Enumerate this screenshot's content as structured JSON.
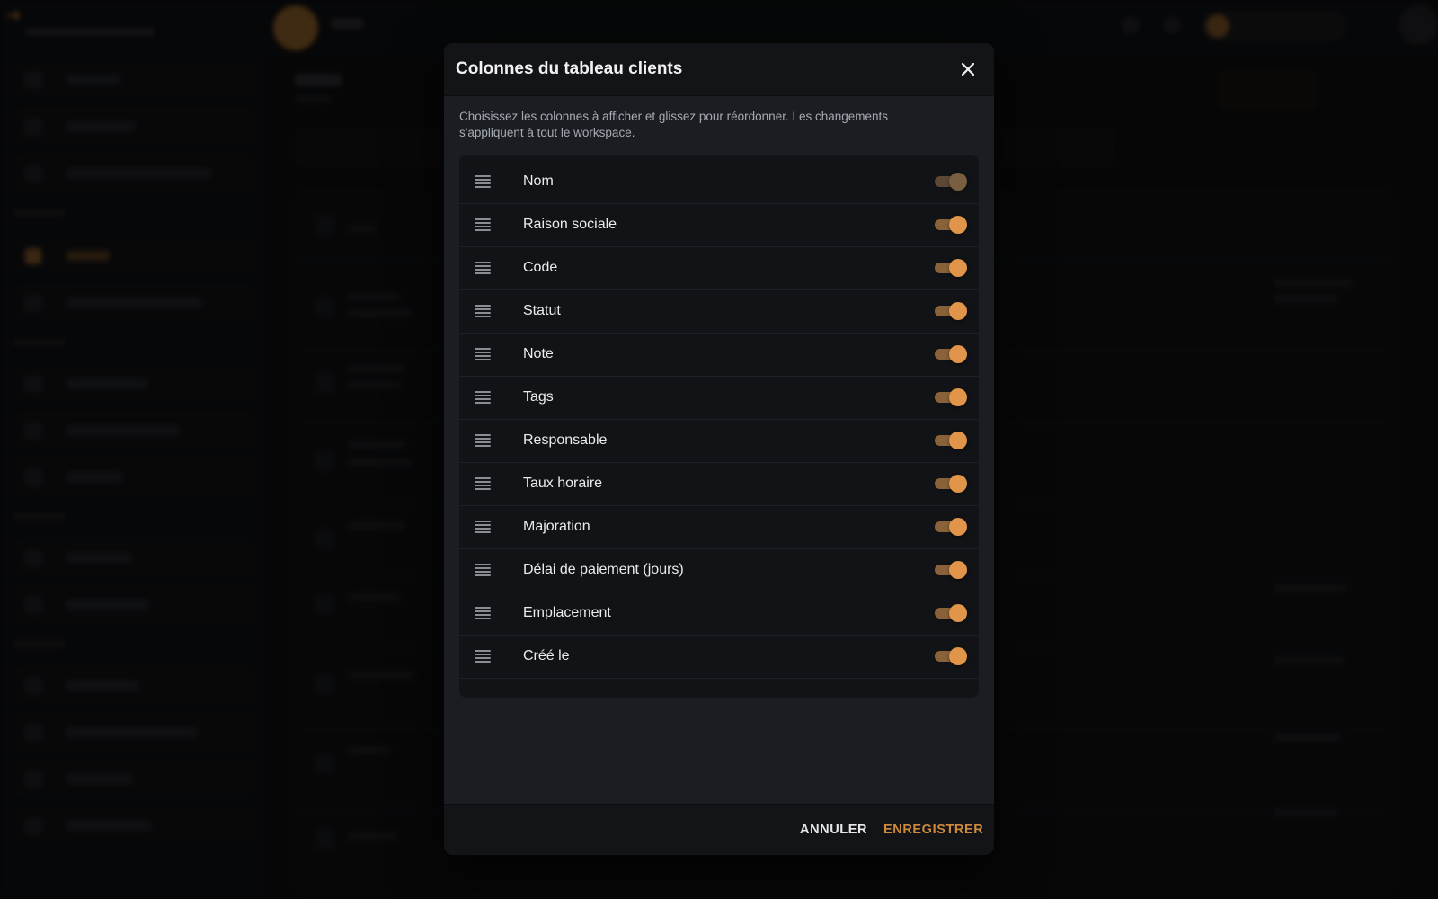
{
  "dialog": {
    "title": "Colonnes du tableau clients",
    "description": "Choisissez les colonnes à afficher et glissez pour réordonner. Les changements s'appliquent à tout le workspace.",
    "columns": [
      {
        "label": "Nom",
        "enabled": true,
        "locked": true
      },
      {
        "label": "Raison sociale",
        "enabled": true
      },
      {
        "label": "Code",
        "enabled": true
      },
      {
        "label": "Statut",
        "enabled": true
      },
      {
        "label": "Note",
        "enabled": true
      },
      {
        "label": "Tags",
        "enabled": true
      },
      {
        "label": "Responsable",
        "enabled": true
      },
      {
        "label": "Taux horaire",
        "enabled": true
      },
      {
        "label": "Majoration",
        "enabled": true
      },
      {
        "label": "Délai de paiement (jours)",
        "enabled": true
      },
      {
        "label": "Emplacement",
        "enabled": true
      },
      {
        "label": "Créé le",
        "enabled": true
      }
    ],
    "cancel_label": "ANNULER",
    "save_label": "ENREGISTRER"
  },
  "colors": {
    "accent": "#d08a3c",
    "dialog_bg": "#1a1d22",
    "list_bg": "#111317"
  },
  "icons": {
    "close": "close-icon",
    "drag": "drag-handle-icon"
  }
}
